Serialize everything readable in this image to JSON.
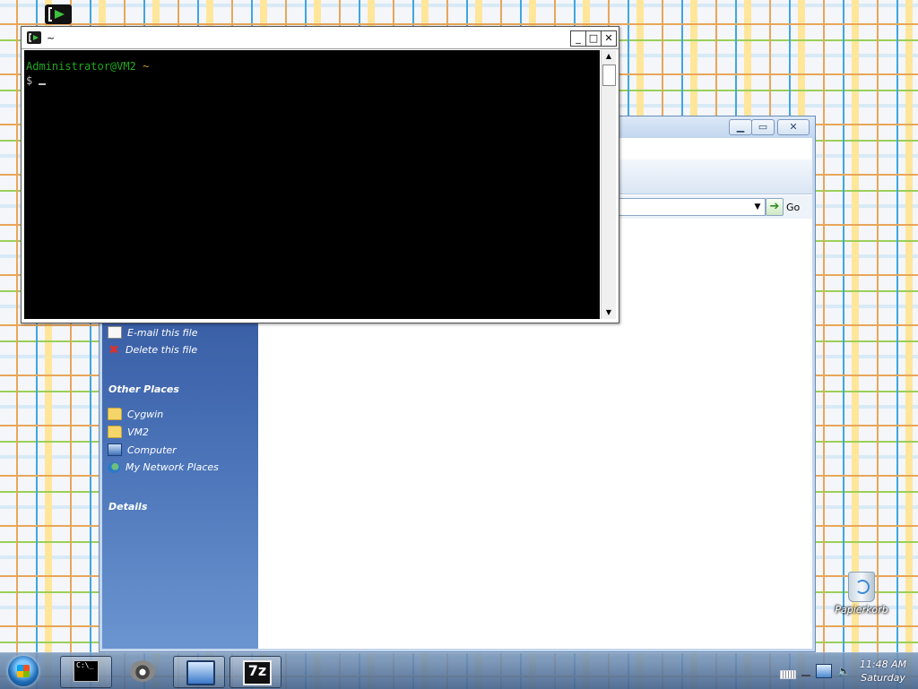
{
  "console": {
    "title": "~",
    "prompt_user": "Administrator@VM2",
    "prompt_cwd": "~",
    "prompt_symbol": "$"
  },
  "explorer": {
    "go_label": "Go",
    "file_tasks": [
      {
        "label": "E-mail this file"
      },
      {
        "label": "Delete this file"
      }
    ],
    "other_places_title": "Other Places",
    "other_places": [
      {
        "label": "Cygwin"
      },
      {
        "label": "VM2"
      },
      {
        "label": "Computer"
      },
      {
        "label": "My Network Places"
      }
    ],
    "details_title": "Details"
  },
  "desktop": {
    "recycle_bin_label": "Papierkorb"
  },
  "taskbar": {
    "console_icon_text": "C:\\_",
    "sevenzip_icon_text": "7z",
    "clock_time": "11:48 AM",
    "clock_day": "Saturday"
  }
}
